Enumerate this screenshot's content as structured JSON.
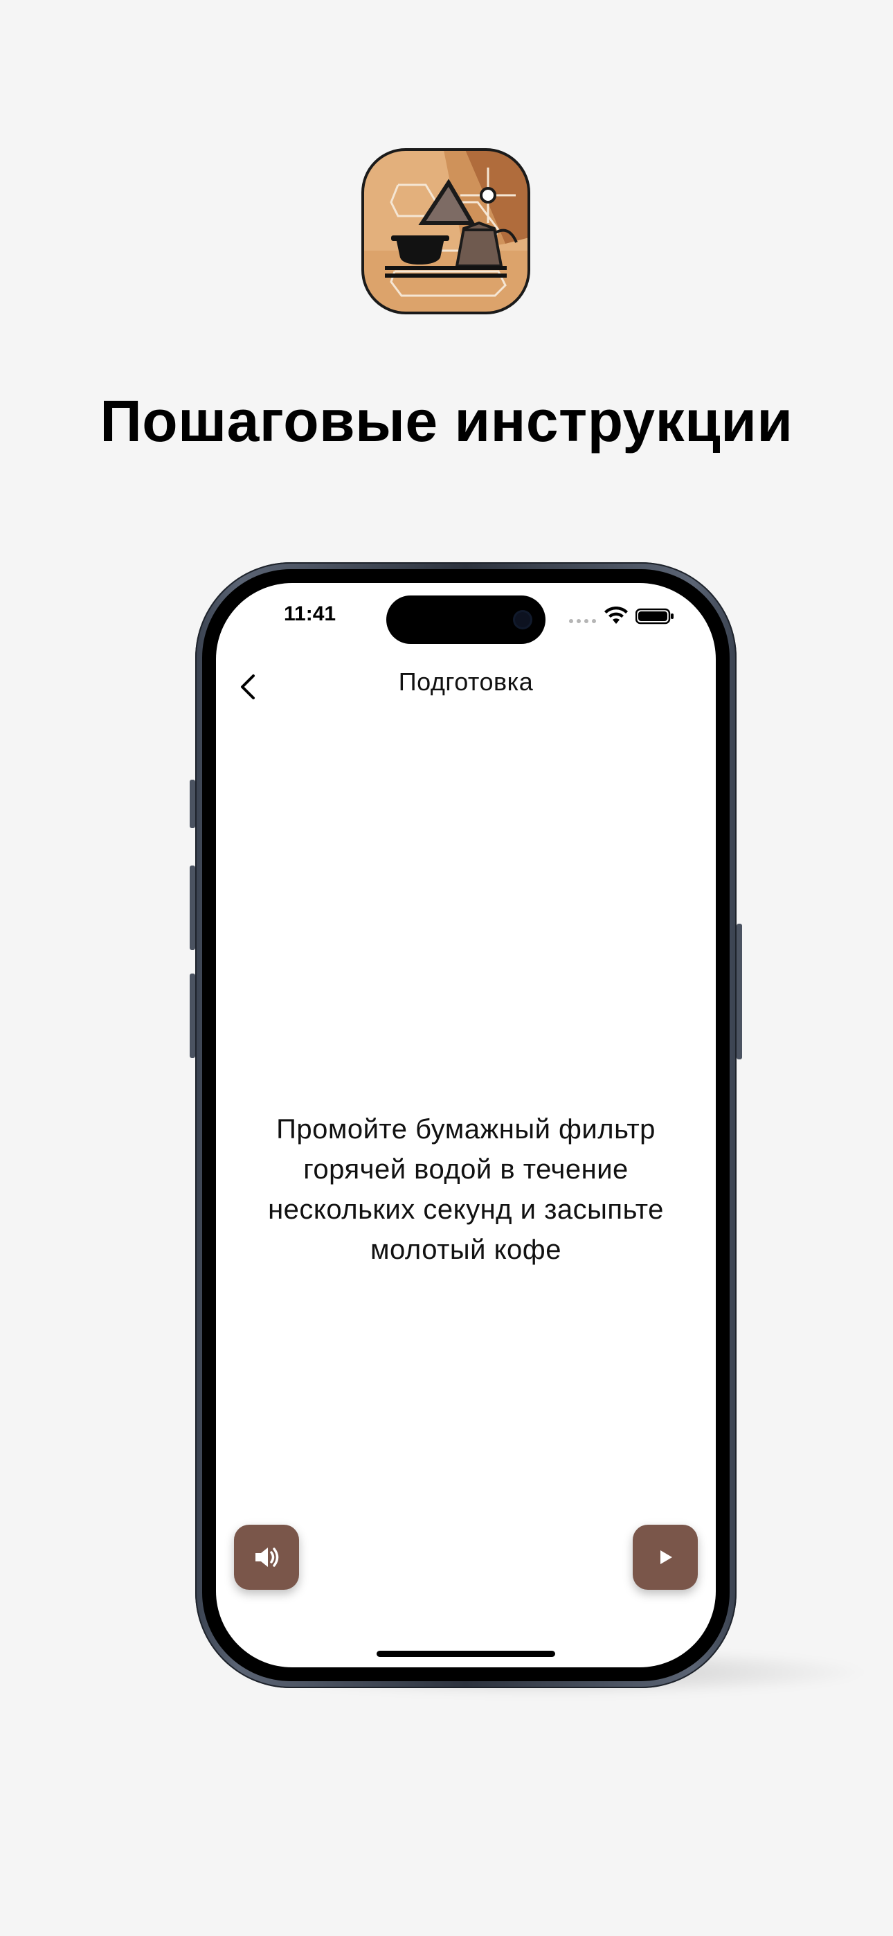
{
  "promo": {
    "title": "Пошаговые инструкции"
  },
  "app_icon": {
    "name": "coffee-brewing-app-icon",
    "colors": {
      "light": "#e3b07c",
      "mid": "#d39a63",
      "dark": "#ad6a3b"
    }
  },
  "status_bar": {
    "time": "11:41",
    "icons": [
      "wifi-icon",
      "battery-icon"
    ]
  },
  "nav": {
    "back_icon": "chevron-left-icon",
    "title": "Подготовка"
  },
  "step": {
    "instruction": "Промойте бумажный фильтр горячей водой в течение нескольких секунд и засыпьте молотый кофе"
  },
  "controls": {
    "sound_icon": "speaker-icon",
    "play_icon": "play-icon",
    "button_color": "#7a564a"
  }
}
